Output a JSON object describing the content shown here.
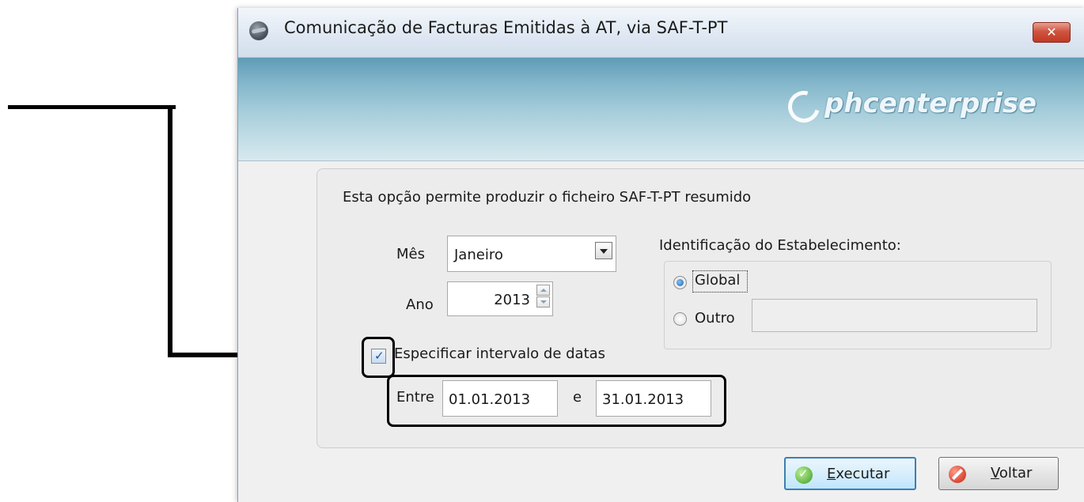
{
  "window": {
    "title": "Comunicação de Facturas Emitidas à AT, via SAF-T-PT",
    "close_label": "✕"
  },
  "banner": {
    "logo_text": "phcenterprise"
  },
  "form": {
    "description": "Esta opção permite produzir o ficheiro SAF-T-PT resumido",
    "month_label": "Mês",
    "month_value": "Janeiro",
    "year_label": "Ano",
    "year_value": "2013",
    "establishment": {
      "label": "Identificação do Estabelecimento:",
      "options": [
        {
          "label": "Global",
          "selected": true
        },
        {
          "label": "Outro",
          "selected": false
        }
      ],
      "other_value": ""
    },
    "date_range": {
      "checkbox_label": "Especificar intervalo de datas",
      "checked": true,
      "between_label": "Entre",
      "start": "01.01.2013",
      "and_label": "e",
      "end": "31.01.2013"
    }
  },
  "buttons": {
    "execute": "Executar",
    "back": "Voltar"
  },
  "colors": {
    "annotation": "#000000",
    "banner_top": "#5e9bb6",
    "close_button": "#c03a25",
    "default_button_border": "#3c7fb1"
  },
  "icons": [
    "app-icon",
    "close-icon",
    "dropdown-arrow-icon",
    "spinner-up-icon",
    "spinner-down-icon",
    "checkmark-icon",
    "execute-check-icon",
    "stop-icon",
    "arrow-icon"
  ]
}
